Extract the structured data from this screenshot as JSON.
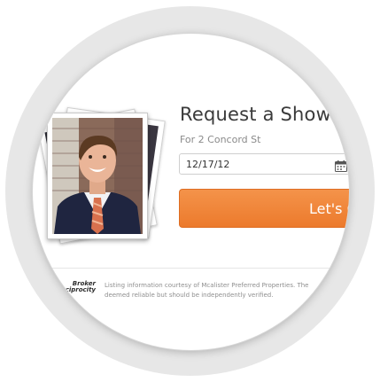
{
  "showing": {
    "title": "Request a Showing",
    "subtitle": "For 2 Concord St",
    "date_value": "12/17/12",
    "submit_label": "Let's Go"
  },
  "footer": {
    "logo_line1": "Broker",
    "logo_line2": "Reciprocity",
    "disclaimer_line1": "Listing information courtesy of Mcalister Preferred Properties. The",
    "disclaimer_line2": "deemed reliable but should be independently verified."
  },
  "icons": {
    "date": "calendar-icon"
  },
  "colors": {
    "accent": "#ec7a2c",
    "title_text": "#3a3a3a",
    "muted_text": "#8a8a8a"
  }
}
